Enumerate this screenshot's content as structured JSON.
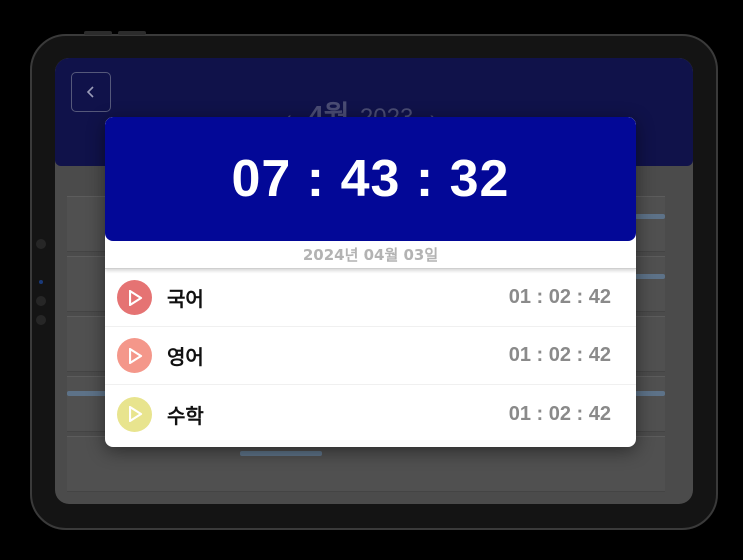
{
  "header": {
    "month": "4월",
    "year": "2023",
    "prev_arrow": "‹",
    "next_arrow": "›"
  },
  "timer": {
    "display": "07 : 43 : 32"
  },
  "date_label": "2024년 04월 03일",
  "subjects": [
    {
      "name": "국어",
      "time": "01 : 02 : 42",
      "color": "#e57373"
    },
    {
      "name": "영어",
      "time": "01 : 02 : 42",
      "color": "#f4978a"
    },
    {
      "name": "수학",
      "time": "01 : 02 : 42",
      "color": "#e8e48e"
    }
  ],
  "colors": {
    "timer_bg": "#030897",
    "header_bg": "#10124a"
  }
}
